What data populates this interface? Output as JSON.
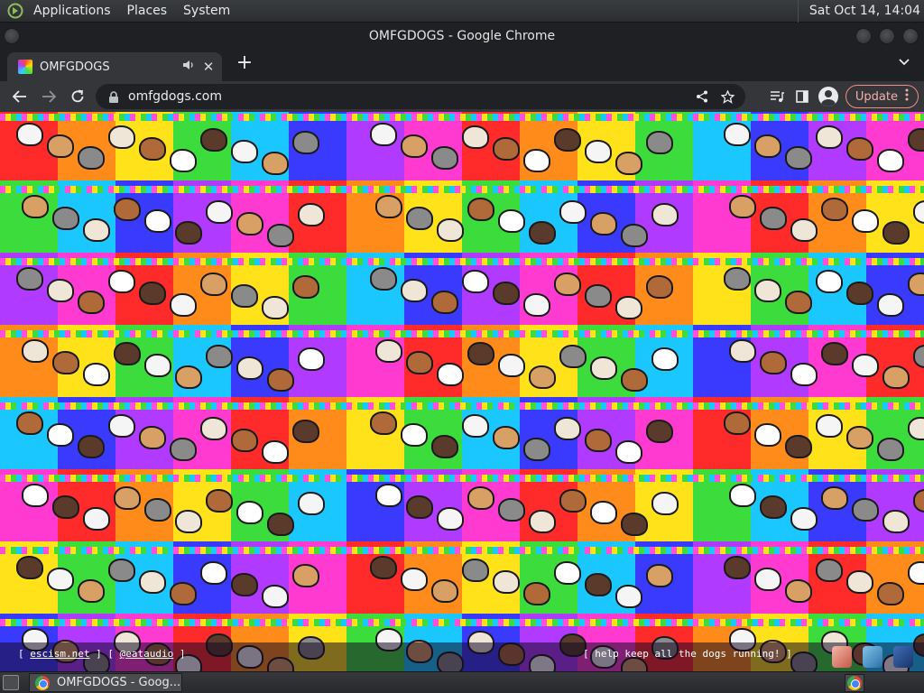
{
  "top_panel": {
    "menus": [
      "Applications",
      "Places",
      "System"
    ],
    "clock": "Sat Oct 14, 14:04"
  },
  "window": {
    "title": "OMFGDOGS - Google Chrome"
  },
  "tab": {
    "title": "OMFGDOGS",
    "favicon": "omfgdogs-favicon",
    "audio_icon": "speaker-icon"
  },
  "toolbar": {
    "url": "omfgdogs.com",
    "update_label": "Update"
  },
  "page": {
    "footer_left": {
      "bracket_open": "[ ",
      "link1": "escism.net",
      "separator": " ] [ ",
      "link2": "@eataudio",
      "bracket_close": " ]"
    },
    "footer_right": "[ help keep all the dogs running! ]",
    "background_colors": [
      "#ff2a2a",
      "#ff8c1a",
      "#ffe21a",
      "#3ddc3d",
      "#1ac8ff",
      "#3a3aff",
      "#b03aff",
      "#ff3ad1"
    ]
  },
  "taskbar": {
    "task_label": "OMFGDOGS - Goog..."
  }
}
